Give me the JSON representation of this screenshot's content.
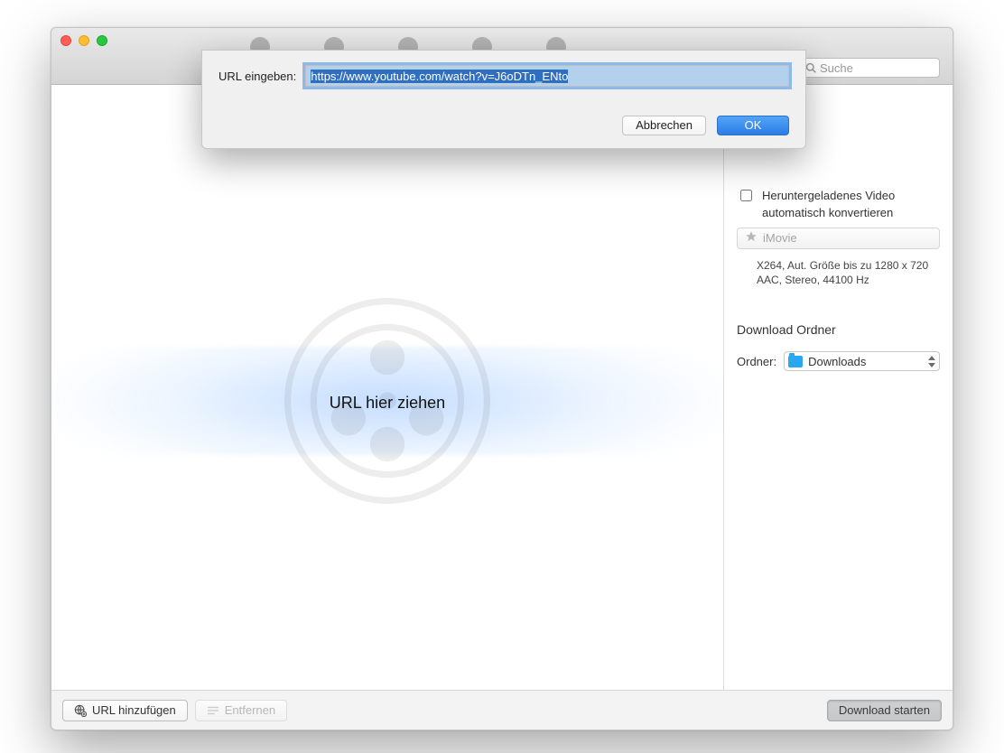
{
  "titlebar": {
    "search_placeholder": "Suche"
  },
  "modal": {
    "label": "URL eingeben:",
    "value": "https://www.youtube.com/watch?v=J6oDTn_ENto",
    "cancel": "Abbrechen",
    "ok": "OK"
  },
  "main": {
    "drop_text": "URL hier ziehen"
  },
  "side": {
    "convert_checkbox_label": "Heruntergeladenes Video automatisch konvertieren",
    "preset_label": "iMovie",
    "codec_line1": "X264, Aut. Größe bis zu 1280 x 720",
    "codec_line2": "AAC, Stereo, 44100 Hz",
    "folder_section_title": "Download Ordner",
    "folder_label": "Ordner:",
    "folder_value": "Downloads"
  },
  "bottom": {
    "add_url": "URL hinzufügen",
    "remove": "Entfernen",
    "download": "Download starten"
  }
}
